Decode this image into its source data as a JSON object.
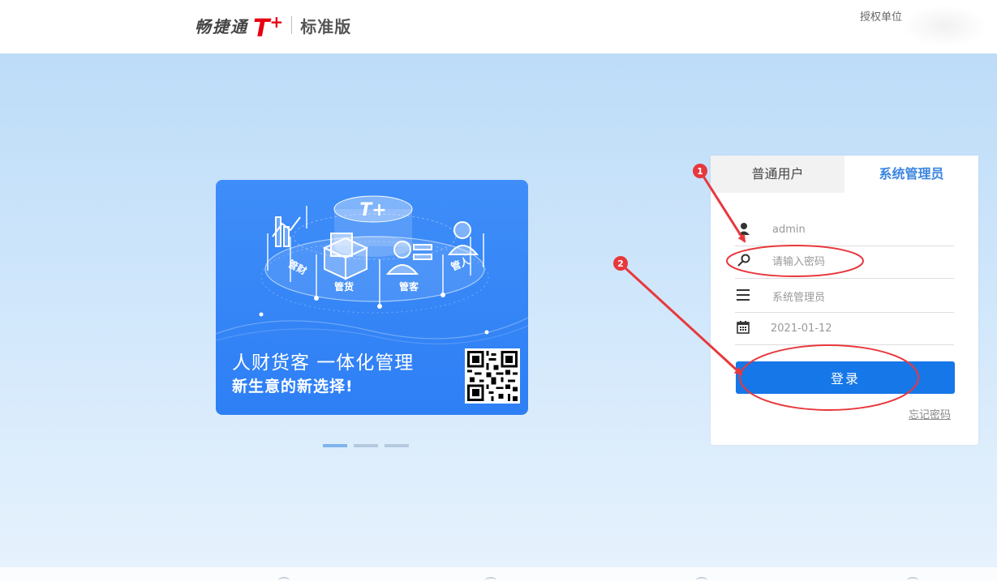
{
  "header": {
    "brand_name": "畅捷通",
    "brand_tplus": "T",
    "brand_plus": "+",
    "edition": "标准版",
    "license_label": "授权单位"
  },
  "banner": {
    "center_logo": "T+",
    "labels": [
      "管财",
      "管货",
      "管客",
      "管人"
    ],
    "title": "人财货客 一体化管理",
    "subtitle": "新生意的新选择!",
    "slides": 3,
    "active_slide": 1
  },
  "login": {
    "tabs": [
      {
        "label": "普通用户",
        "active": false
      },
      {
        "label": "系统管理员",
        "active": true
      }
    ],
    "username_value": "admin",
    "password_placeholder": "请输入密码",
    "role_value": "系统管理员",
    "date_value": "2021-01-12",
    "login_button": "登录",
    "forgot_link": "忘记密码"
  },
  "annotations": {
    "markers": [
      "1",
      "2"
    ],
    "color": "#e8383d"
  },
  "colors": {
    "brand_red": "#e60012",
    "accent_blue": "#1577e8",
    "tab_active": "#3b86e0",
    "banner_blue": "#3e8df9"
  }
}
